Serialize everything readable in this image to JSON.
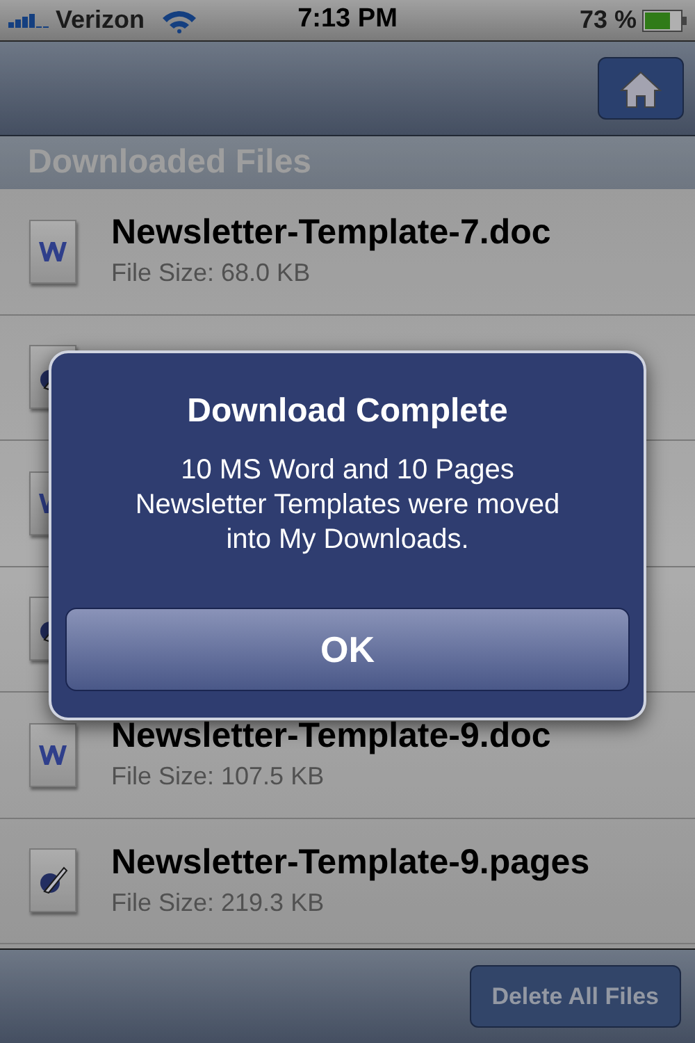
{
  "status_bar": {
    "carrier": "Verizon",
    "time": "7:13 PM",
    "battery": "73 %"
  },
  "section_header": "Downloaded Files",
  "files": [
    {
      "kind": "doc",
      "name": "Newsletter-Template-7.doc",
      "size": "File Size: 68.0 KB"
    },
    {
      "kind": "pages"
    },
    {
      "kind": "doc"
    },
    {
      "kind": "pages"
    },
    {
      "kind": "doc",
      "name": "Newsletter-Template-9.doc",
      "size": "File Size: 107.5 KB"
    },
    {
      "kind": "pages",
      "name": "Newsletter-Template-9.pages",
      "size": "File Size: 219.3 KB"
    }
  ],
  "toolbar": {
    "button": "Delete All Files"
  },
  "alert": {
    "title": "Download Complete",
    "message": "10 MS Word and 10 Pages Newsletter Templates were moved into My Downloads.",
    "button": "OK"
  }
}
